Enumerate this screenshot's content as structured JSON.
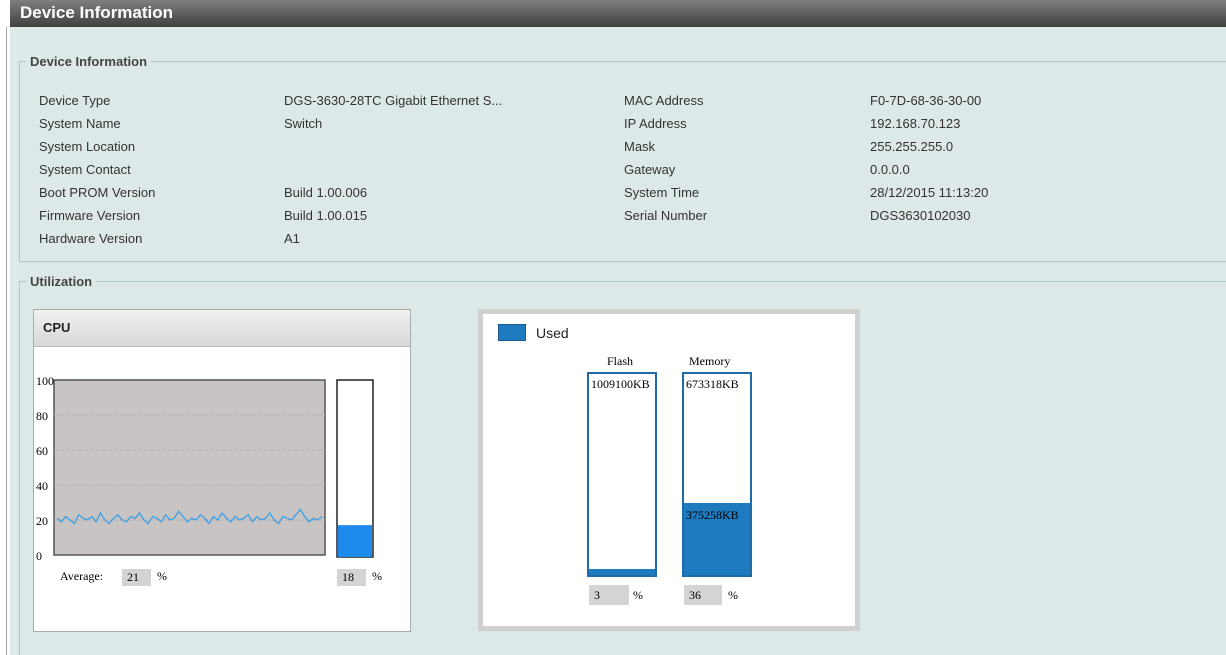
{
  "page": {
    "title": "Device Information"
  },
  "device_info": {
    "legend": "Device Information",
    "left": [
      {
        "label": "Device Type",
        "value": "DGS-3630-28TC Gigabit Ethernet S..."
      },
      {
        "label": "System Name",
        "value": "Switch"
      },
      {
        "label": "System Location",
        "value": ""
      },
      {
        "label": "System Contact",
        "value": ""
      },
      {
        "label": "Boot PROM Version",
        "value": "Build 1.00.006"
      },
      {
        "label": "Firmware Version",
        "value": "Build 1.00.015"
      },
      {
        "label": "Hardware Version",
        "value": "A1"
      }
    ],
    "right": [
      {
        "label": "MAC Address",
        "value": "F0-7D-68-36-30-00"
      },
      {
        "label": "IP Address",
        "value": "192.168.70.123"
      },
      {
        "label": "Mask",
        "value": "255.255.255.0"
      },
      {
        "label": "Gateway",
        "value": "0.0.0.0"
      },
      {
        "label": "System Time",
        "value": "28/12/2015 11:13:20"
      },
      {
        "label": "Serial Number",
        "value": "DGS3630102030"
      }
    ]
  },
  "utilization": {
    "legend": "Utilization",
    "cpu": {
      "title": "CPU",
      "y_ticks": [
        "100",
        "80",
        "60",
        "40",
        "20",
        "0"
      ],
      "y_tick_values": [
        100,
        80,
        60,
        40,
        20,
        0
      ],
      "history": [
        21,
        19,
        22,
        20,
        18,
        23,
        21,
        20,
        22,
        19,
        24,
        20,
        18,
        21,
        23,
        20,
        19,
        22,
        21,
        24,
        20,
        18,
        22,
        21,
        19,
        23,
        20,
        21,
        25,
        22,
        19,
        21,
        20,
        23,
        21,
        18,
        22,
        20,
        24,
        21,
        19,
        22,
        20,
        21,
        23,
        19,
        22,
        20,
        21,
        24,
        20,
        18,
        22,
        21,
        20,
        23,
        26,
        22,
        19,
        21,
        20,
        22
      ],
      "average_label": "Average:",
      "average_value": "21",
      "average_unit": "%",
      "current_percent": 18,
      "current_value": "18",
      "current_unit": "%",
      "colors": {
        "line": "#3aa0e8",
        "bar": "#1e8bec",
        "plot_bg": "#c9c4c4"
      }
    },
    "storage": {
      "legend_label": "Used",
      "legend_color": "#1e7bc0",
      "flash": {
        "title": "Flash",
        "total": "1009100KB",
        "used": "",
        "percent": 3,
        "percent_value": "3",
        "unit": "%"
      },
      "memory": {
        "title": "Memory",
        "total": "673318KB",
        "used": "375258KB",
        "percent": 36,
        "percent_value": "36",
        "unit": "%"
      }
    }
  }
}
